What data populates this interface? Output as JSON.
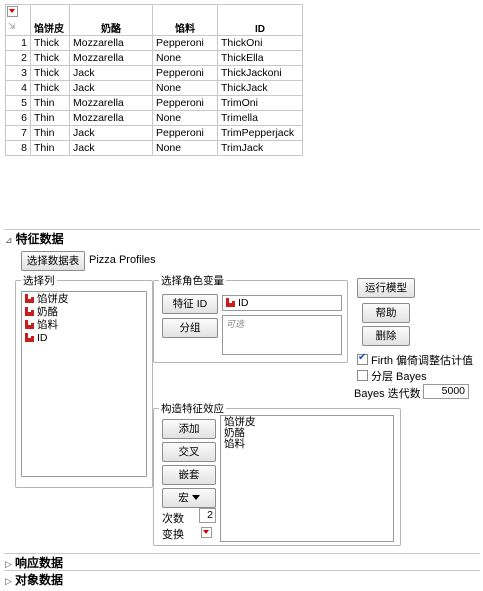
{
  "table": {
    "headers": [
      "馅饼皮",
      "奶酪",
      "馅料",
      "ID"
    ],
    "rows": [
      [
        "1",
        "Thick",
        "Mozzarella",
        "Pepperoni",
        "ThickOni"
      ],
      [
        "2",
        "Thick",
        "Mozzarella",
        "None",
        "ThickElla"
      ],
      [
        "3",
        "Thick",
        "Jack",
        "Pepperoni",
        "ThickJackoni"
      ],
      [
        "4",
        "Thick",
        "Jack",
        "None",
        "ThickJack"
      ],
      [
        "5",
        "Thin",
        "Mozzarella",
        "Pepperoni",
        "TrimOni"
      ],
      [
        "6",
        "Thin",
        "Mozzarella",
        "None",
        "Trimella"
      ],
      [
        "7",
        "Thin",
        "Jack",
        "Pepperoni",
        "TrimPepperjack"
      ],
      [
        "8",
        "Thin",
        "Jack",
        "None",
        "TrimJack"
      ]
    ]
  },
  "feature_section": {
    "title": "特征数据",
    "select_table_button": "选择数据表",
    "table_name": "Pizza Profiles",
    "select_columns": {
      "legend": "选择列",
      "items": [
        "馅饼皮",
        "奶酪",
        "馅料",
        "ID"
      ]
    },
    "roles": {
      "legend": "选择角色变量",
      "feature_id_button": "特征 ID",
      "feature_id_value": "ID",
      "group_button": "分组",
      "group_placeholder": "可选"
    },
    "actions": {
      "run_model": "运行模型",
      "help": "帮助",
      "remove": "删除"
    },
    "options": {
      "firth_label": "Firth 偏倚调整估计值",
      "firth_checked": true,
      "hier_bayes_label": "分层 Bayes",
      "hier_bayes_checked": false,
      "bayes_iter_label": "Bayes 迭代数",
      "bayes_iter_value": "5000"
    },
    "construct": {
      "legend": "构造特征效应",
      "add": "添加",
      "cross": "交叉",
      "nest": "嵌套",
      "macro": "宏",
      "degree_label": "次数",
      "degree_value": "2",
      "transform_label": "变换",
      "effects": [
        "馅饼皮",
        "奶酪",
        "馅料"
      ]
    }
  },
  "collapsed_sections": {
    "response": "响应数据",
    "subject": "对象数据"
  },
  "colors": {
    "accent_red": "#c81e1e",
    "check_blue": "#1a4fb0"
  }
}
